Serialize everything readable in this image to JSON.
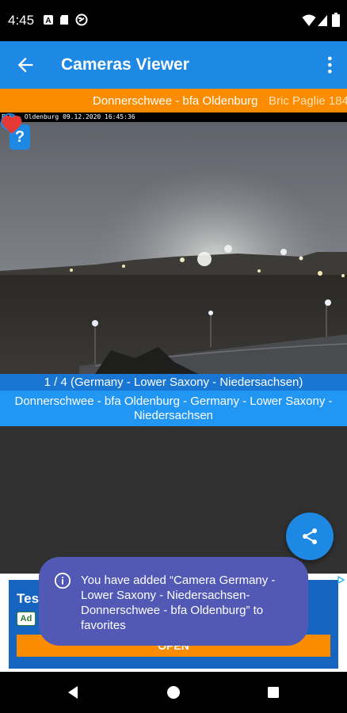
{
  "status_bar": {
    "time": "4:45",
    "left_icons": [
      "a-notification-icon",
      "sd-card-icon",
      "sync-icon"
    ],
    "right_icons": [
      "wifi-icon",
      "signal-icon",
      "battery-icon"
    ]
  },
  "app_bar": {
    "title": "Cameras Viewer",
    "back_icon": "arrow-back-icon",
    "menu_icon": "more-vert-icon"
  },
  "marquee": {
    "current": "Donnerschwee - bfa Oldenburg",
    "next": "Bric Paglie 184"
  },
  "camera": {
    "timestamp_overlay": "BFE ~ Oldenburg 09.12.2020 16:45:36",
    "help_label": "?",
    "icons": [
      "help-icon",
      "globe-icon",
      "phone-icon",
      "favorite-heart-icon"
    ]
  },
  "counter": "1 / 4 (Germany - Lower Saxony - Niedersachsen)",
  "description": {
    "line1": "Donnerschwee - bfa Oldenburg - Germany - Lower Saxony -",
    "line2": "Niedersachsen"
  },
  "ad": {
    "brand_partial": "Test",
    "badge": "Ad",
    "cta": "OPEN"
  },
  "toast": {
    "message": "You have added “Camera Germany - Lower Saxony - Niedersachsen-Donnerschwee - bfa Oldenburg” to favorites"
  },
  "nav_bar": [
    "back-triangle-icon",
    "home-circle-icon",
    "recents-square-icon"
  ],
  "colors": {
    "app_bar": "#1e88e5",
    "marquee": "#fb8c00",
    "counter": "#1976d2",
    "description": "#2196f3",
    "toast": "#5159b5",
    "favorite": "#e53935"
  }
}
